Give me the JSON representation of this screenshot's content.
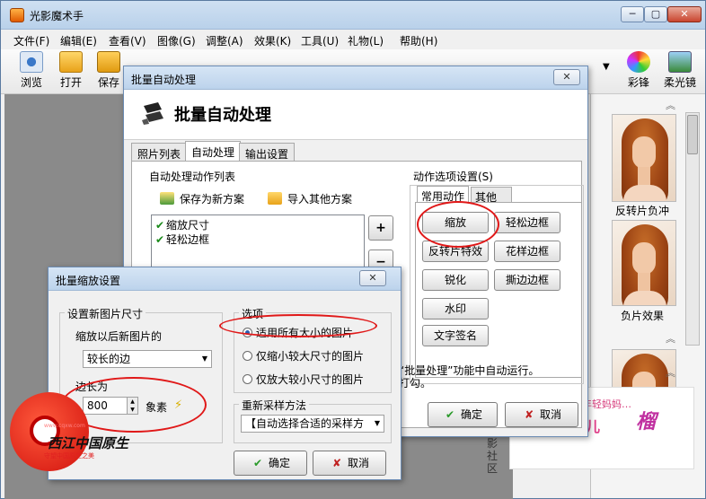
{
  "window": {
    "title": "光影魔术手",
    "controls": {
      "min": "─",
      "max": "▢",
      "close": "✕"
    }
  },
  "menu": [
    "文件(F)",
    "编辑(E)",
    "查看(V)",
    "图像(G)",
    "调整(A)",
    "效果(K)",
    "工具(U)",
    "礼物(L)",
    "帮助(H)"
  ],
  "toolbar": {
    "browse": "浏览",
    "open": "打开",
    "save": "保存",
    "rainbow": "彩锋",
    "soft": "柔光镜"
  },
  "right_panel": {
    "captions": [
      "反转片负冲",
      "负片效果"
    ],
    "vertical_text": "影社区",
    "banner_top": "年轻妈妈…",
    "banner_main": "子育儿",
    "banner_logo": "榴"
  },
  "batch_dialog": {
    "title": "批量自动处理",
    "heading": "批量自动处理",
    "tabs": [
      "照片列表",
      "自动处理",
      "输出设置"
    ],
    "list_title": "自动处理动作列表",
    "save_scheme": "保存为新方案",
    "import_scheme": "导入其他方案",
    "actions": [
      "缩放尺寸",
      "轻松边框"
    ],
    "add": "+",
    "remove": "−",
    "options_title": "动作选项设置(S)",
    "option_tabs": [
      "常用动作",
      "其他"
    ],
    "option_buttons": [
      "缩放",
      "轻松边框",
      "反转片特效",
      "花样边框",
      "锐化",
      "撕边边框",
      "水印",
      "文字签名"
    ],
    "note_1": "“批量处理”功能中自动运行。",
    "note_2": "打勾。",
    "ok": "确定",
    "cancel": "取消"
  },
  "resize_dialog": {
    "title": "批量缩放设置",
    "size_group": "设置新图片尺寸",
    "scale_label": "缩放以后新图片的",
    "side_select": "较长的边",
    "edge_label": "边长为",
    "edge_value": "800",
    "unit": "象素",
    "options_group": "选项",
    "radio_all": "适用所有大小的图片",
    "radio_shrink": "仅缩小较大尺寸的图片",
    "radio_enlarge": "仅放大较小尺寸的图片",
    "resample_group": "重新采样方法",
    "resample_select": "【自动选择合适的采样方",
    "ok": "确定",
    "cancel": "取消"
  },
  "watermark": {
    "text": "西江中国原生",
    "sub": "守望中国原生之美",
    "url": "www.cqxw.com"
  },
  "colors": {
    "accent_red": "#e01818",
    "check_green": "#1a8a1a",
    "title_bar": "#bcd3ec"
  }
}
